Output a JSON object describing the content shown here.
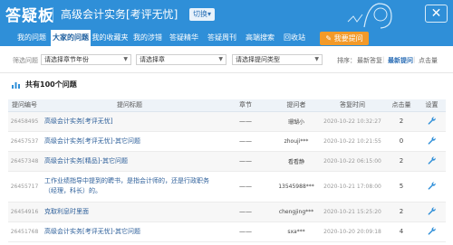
{
  "header": {
    "brand": "答疑板",
    "course": "高级会计实务[考评无忧]",
    "switch_label": "切换▾",
    "close_symbol": "✕"
  },
  "nav": {
    "items": [
      {
        "label": "我的问题",
        "active": false
      },
      {
        "label": "大家的问题",
        "active": true
      },
      {
        "label": "我的收藏夹",
        "active": false
      },
      {
        "label": "我的涉错",
        "active": false
      },
      {
        "label": "答疑精华",
        "active": false
      },
      {
        "label": "答疑周刊",
        "active": false
      },
      {
        "label": "高端搜索",
        "active": false
      },
      {
        "label": "回收站",
        "active": false
      }
    ],
    "ask_button": "我要提问"
  },
  "filter": {
    "label": "筛选问题",
    "select_chapter_year": "请选择章节年份",
    "select_chapter": "请选择章",
    "select_type": "请选择提问类型",
    "sort_label": "排序：",
    "sort_options": [
      {
        "label": "最新答复",
        "active": false
      },
      {
        "label": "最新提问",
        "active": true
      },
      {
        "label": "点击量",
        "active": false
      }
    ]
  },
  "summary": {
    "text": "共有100个问题"
  },
  "table": {
    "headers": [
      "提问编号",
      "提问标题",
      "章节",
      "提问者",
      "答复时间",
      "点击量",
      "设置"
    ],
    "rows": [
      {
        "id": "26458495",
        "title": "高级会计实务[考评无忧]",
        "chapter": "——",
        "asker": "珊瑚小",
        "time": "2020-10-22 10:32:27",
        "clicks": "2"
      },
      {
        "id": "26457537",
        "title": "高级会计实务[考评无忧]-其它问题",
        "chapter": "——",
        "asker": "zhouji***",
        "time": "2020-10-22 10:21:55",
        "clicks": "0"
      },
      {
        "id": "26457348",
        "title": "高级会计实务[精品]-其它问题",
        "chapter": "——",
        "asker": "看看静",
        "time": "2020-10-22 06:15:00",
        "clicks": "2"
      },
      {
        "id": "26455717",
        "title": "工作业绩指导中提到的聘书，是指会计师的，还是行政职务（经理，科长）的。",
        "chapter": "——",
        "asker": "13545988***",
        "time": "2020-10-21 17:08:00",
        "clicks": "5"
      },
      {
        "id": "26454916",
        "title": "克取利息时里面",
        "chapter": "——",
        "asker": "chengjing***",
        "time": "2020-10-21 15:25:20",
        "clicks": "2"
      },
      {
        "id": "26451768",
        "title": "高级会计实务[考评无忧]-其它问题",
        "chapter": "——",
        "asker": "sxa***",
        "time": "2020-10-20 20:09:18",
        "clicks": "4"
      }
    ]
  },
  "colors": {
    "header_blue": "#2f8fd8",
    "ask_orange": "#f39a29",
    "link_blue": "#2d5f9a"
  }
}
